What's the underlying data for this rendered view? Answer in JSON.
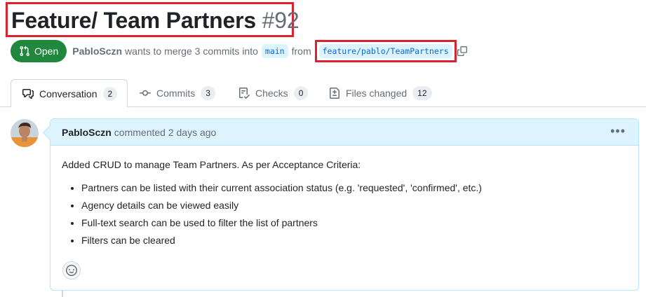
{
  "pr": {
    "title": "Feature/ Team Partners",
    "number": "#92",
    "state": "Open",
    "author": "PabloSczn",
    "merge_text": "wants to merge 3 commits into",
    "base_branch": "main",
    "from_text": "from",
    "head_branch": "feature/pablo/TeamPartners"
  },
  "tabs": [
    {
      "label": "Conversation",
      "count": "2",
      "icon": "comment-discussion-icon"
    },
    {
      "label": "Commits",
      "count": "3",
      "icon": "git-commit-icon"
    },
    {
      "label": "Checks",
      "count": "0",
      "icon": "checklist-icon"
    },
    {
      "label": "Files changed",
      "count": "12",
      "icon": "file-diff-icon"
    }
  ],
  "comment": {
    "author": "PabloSczn",
    "action": "commented 2 days ago",
    "intro": "Added CRUD to manage Team Partners. As per Acceptance Criteria:",
    "items": [
      "Partners can be listed with their current association status (e.g. 'requested', 'confirmed', etc.)",
      "Agency details can be viewed easily",
      "Full-text search can be used to filter the list of partners",
      "Filters can be cleared"
    ]
  },
  "colors": {
    "open_green": "#1f883d",
    "highlight_red": "#d9232e",
    "branch_bg": "#ddf4ff",
    "link_blue": "#0969da"
  }
}
